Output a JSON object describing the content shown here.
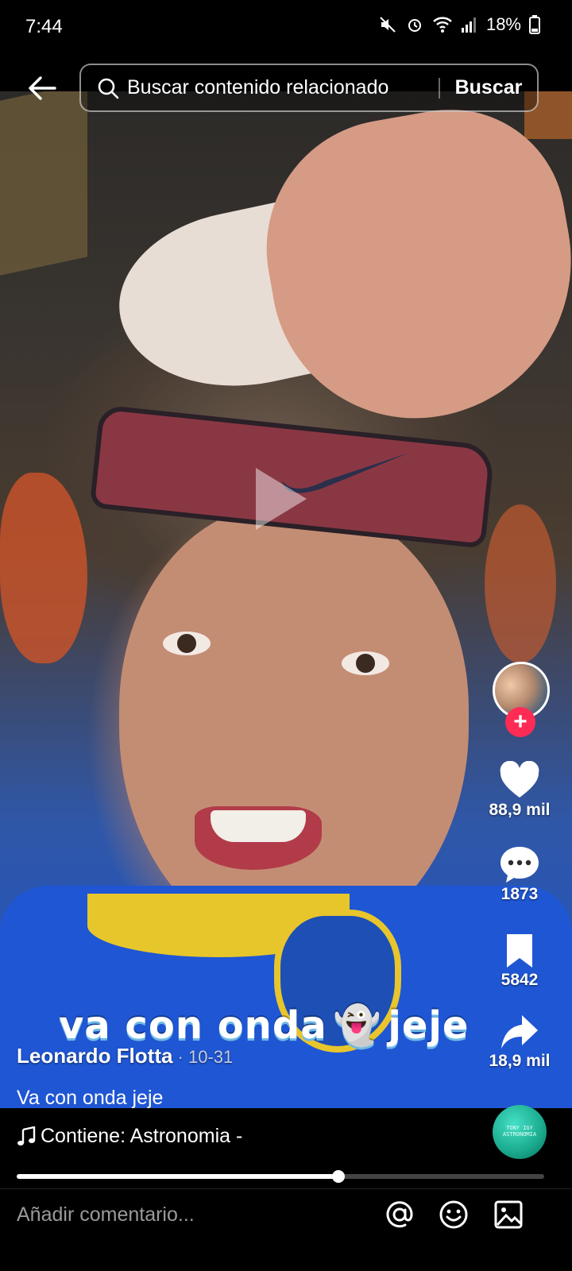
{
  "status_bar": {
    "time": "7:44",
    "battery": "18%"
  },
  "search": {
    "placeholder": "Buscar contenido relacionado",
    "button_label": "Buscar"
  },
  "video": {
    "overlay_text_left": "va con onda",
    "overlay_emoji": "👻",
    "overlay_text_right": "jeje",
    "author": "Leonardo Flotta",
    "date": " · 10-31",
    "progress_fraction": 0.61
  },
  "actions": {
    "likes": "88,9 mil",
    "comments": "1873",
    "saves": "5842",
    "shares": "18,9 mil"
  },
  "info": {
    "description": "Va con onda jeje",
    "music": "Contiene: Astronomia -",
    "music_disc_label": "TONY IGY ASTRONOMIA"
  },
  "comment_bar": {
    "placeholder": "Añadir comentario..."
  },
  "colors": {
    "follow": "#fe2c55",
    "background": "#000000"
  }
}
